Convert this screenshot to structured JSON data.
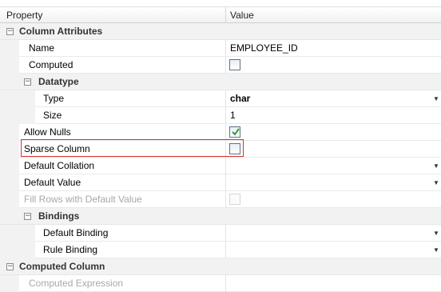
{
  "header": {
    "property": "Property",
    "value": "Value"
  },
  "rows": [
    {
      "label": "Column Attributes",
      "value": ""
    },
    {
      "label": "Name",
      "value": "EMPLOYEE_ID"
    },
    {
      "label": "Computed",
      "value": ""
    },
    {
      "label": "Datatype",
      "value": ""
    },
    {
      "label": "Type",
      "value": "char"
    },
    {
      "label": "Size",
      "value": "1"
    },
    {
      "label": "Allow Nulls",
      "value": ""
    },
    {
      "label": "Sparse Column",
      "value": ""
    },
    {
      "label": "Default Collation",
      "value": ""
    },
    {
      "label": "Default Value",
      "value": ""
    },
    {
      "label": "Fill Rows with Default Value",
      "value": ""
    },
    {
      "label": "Bindings",
      "value": ""
    },
    {
      "label": "Default Binding",
      "value": ""
    },
    {
      "label": "Rule Binding",
      "value": ""
    },
    {
      "label": "Computed Column",
      "value": ""
    },
    {
      "label": "Computed Expression",
      "value": ""
    }
  ],
  "checkboxes": {
    "computed": false,
    "allow_nulls": true,
    "sparse_column": false,
    "fill_rows_with_default_value": false
  },
  "colors": {
    "highlight": "#d9332f",
    "check": "#2e9e3e",
    "disabled_text": "#a8a8a8"
  }
}
